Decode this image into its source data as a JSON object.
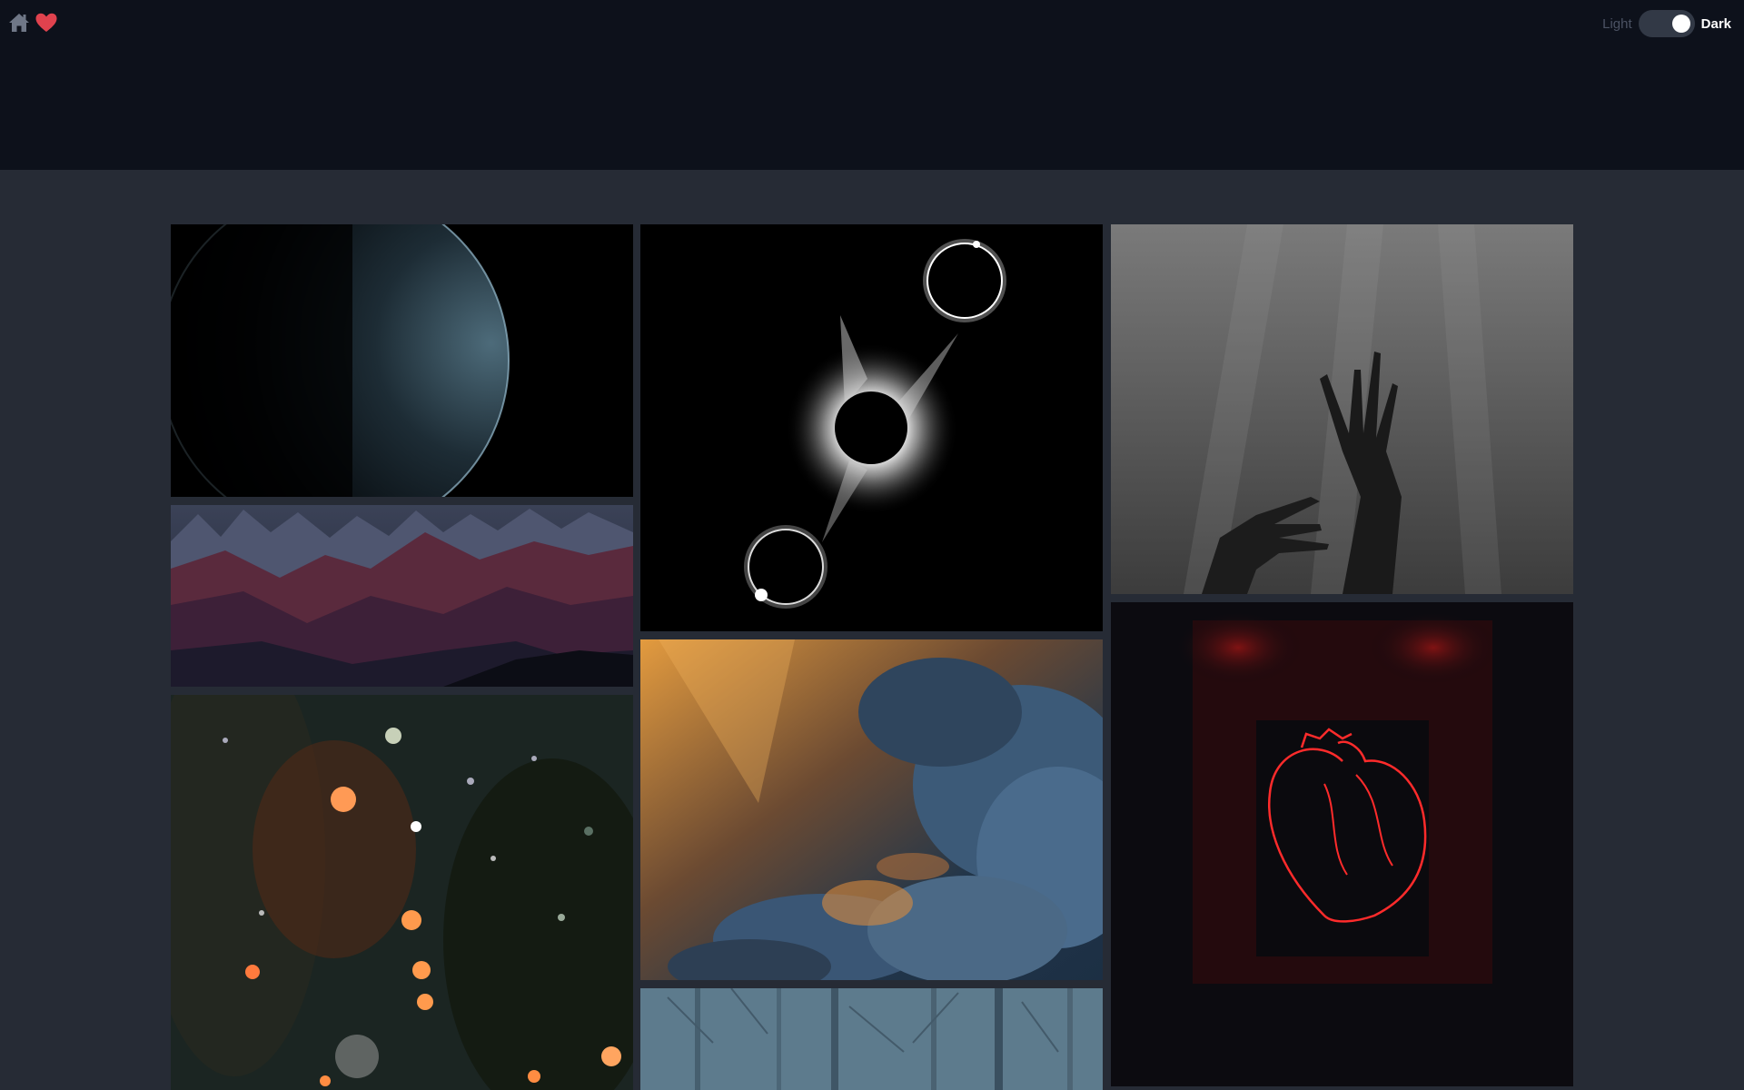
{
  "header": {
    "nav": [
      {
        "icon": "home-icon"
      },
      {
        "icon": "heart-icon"
      }
    ],
    "theme": {
      "light_label": "Light",
      "dark_label": "Dark",
      "mode": "dark"
    }
  },
  "colors": {
    "header_bg": "#0d111b",
    "page_bg": "#262b35",
    "heart": "#e0424e",
    "home": "#6f7787"
  },
  "gallery": {
    "columns": [
      [
        "planet-limb",
        "mountain-range",
        "bokeh-night-lights"
      ],
      [
        "solar-eclipse-sequence",
        "sunlit-clouds",
        "misty-forest"
      ],
      [
        "underwater-hands",
        "neon-heart-sign"
      ]
    ]
  }
}
